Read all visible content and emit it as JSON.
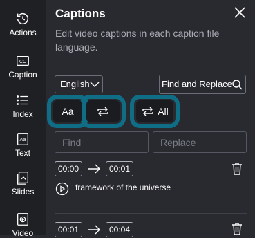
{
  "sidebar": {
    "items": [
      {
        "label": "Actions",
        "icon": "history-icon"
      },
      {
        "label": "Caption",
        "icon": "cc-icon"
      },
      {
        "label": "Index",
        "icon": "list-icon"
      },
      {
        "label": "Text",
        "icon": "text-box-icon"
      },
      {
        "label": "Slides",
        "icon": "slides-icon"
      },
      {
        "label": "Video",
        "icon": "video-icon"
      }
    ]
  },
  "panel": {
    "title": "Captions",
    "subtitle": "Edit video captions in each caption file language.",
    "language": "English",
    "find_replace_label": "Find and Replace",
    "toggles": {
      "match_case": "Aa",
      "replace_all": "All"
    },
    "find_placeholder": "Find",
    "replace_placeholder": "Replace"
  },
  "captions": [
    {
      "start": "00:00",
      "end": "00:01",
      "text": "framework of the universe"
    },
    {
      "start": "00:01",
      "end": "00:04",
      "text": ""
    }
  ],
  "colors": {
    "background": "#292a30",
    "sidebar": "#1f2024",
    "highlight_ring": "#0f6d86",
    "button_bg": "#1b1c20"
  }
}
